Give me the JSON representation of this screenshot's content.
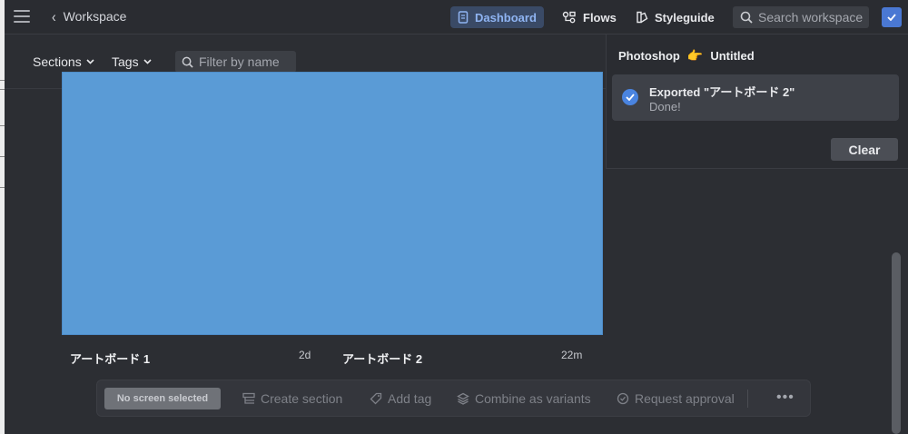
{
  "topbar": {
    "back_label": "Workspace",
    "nav": [
      {
        "label": "Dashboard",
        "icon": "document-icon",
        "active": true
      },
      {
        "label": "Flows",
        "icon": "flows-icon",
        "active": false
      },
      {
        "label": "Styleguide",
        "icon": "styleguide-icon",
        "active": false
      }
    ],
    "search_placeholder": "Search workspace"
  },
  "filters": {
    "sections_label": "Sections",
    "tags_label": "Tags",
    "filter_placeholder": "Filter by name"
  },
  "artboards": [
    {
      "name": "アートボード 1",
      "time": "2d",
      "color": "#5a9bd6"
    },
    {
      "name": "アートボード 2",
      "time": "22m"
    }
  ],
  "toolbar": {
    "selection_badge": "No screen selected",
    "create_section": "Create section",
    "add_tag": "Add tag",
    "combine_variants": "Combine as variants",
    "request_approval": "Request approval",
    "more": "•••"
  },
  "panel": {
    "source": "Photoshop",
    "arrow_emoji": "👉",
    "document": "Untitled",
    "notification_title": "Exported \"アートボード 2\"",
    "notification_status": "Done!",
    "clear_label": "Clear"
  }
}
